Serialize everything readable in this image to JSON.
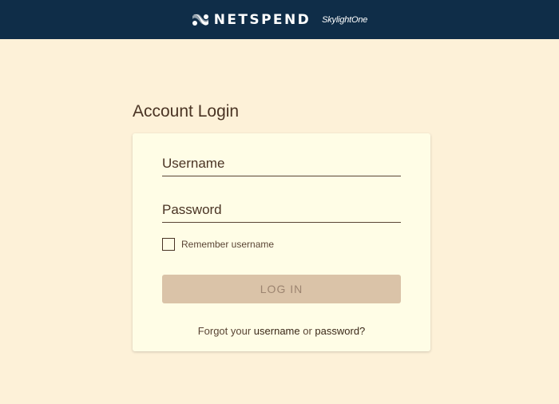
{
  "header": {
    "brand_name": "NETSPEND",
    "brand_sub": "SkylightOne",
    "logo_icon": "netspend-logo-icon"
  },
  "login": {
    "title": "Account Login",
    "username_placeholder": "Username",
    "password_placeholder": "Password",
    "remember_label": "Remember username",
    "remember_checked": false,
    "login_button": "LOG IN",
    "forgot_prefix": "Forgot your",
    "forgot_username": "username",
    "forgot_or": "or",
    "forgot_password": "password?"
  },
  "colors": {
    "header_bg": "#0f2d48",
    "page_bg": "#fdf1d8",
    "card_bg": "#fffde6",
    "button_bg": "#dac3a8",
    "text": "#4a3424"
  }
}
